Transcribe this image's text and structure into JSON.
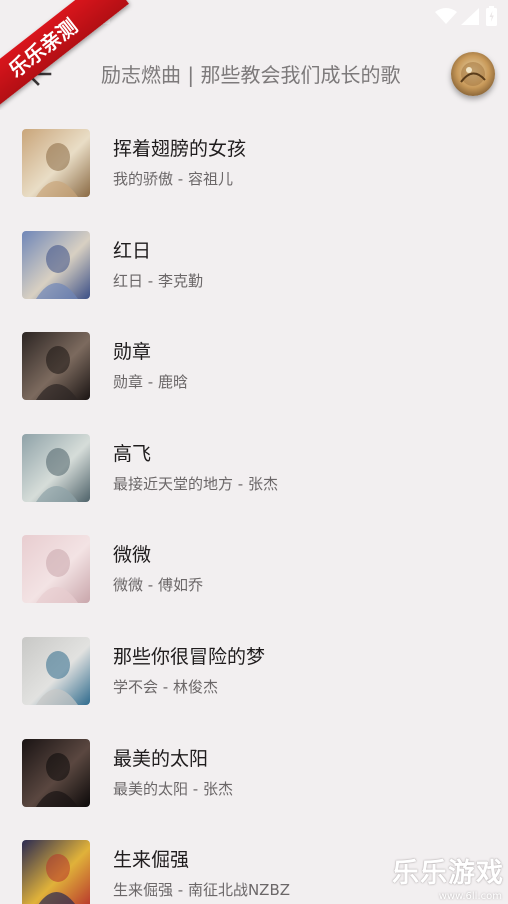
{
  "watermark": {
    "ribbon_text": "乐乐亲测",
    "logo_text": "乐乐游戏",
    "url": "www.6ll.com"
  },
  "status_bar": {
    "icons": [
      "a-notification-icon",
      "wifi-icon",
      "signal-icon",
      "battery-icon"
    ]
  },
  "app_bar": {
    "back_icon": "arrow-back-icon",
    "title": "励志燃曲 | 那些教会我们成长的歌",
    "avatar_icon": "playlist-avatar"
  },
  "songs": [
    {
      "title": "挥着翅膀的女孩",
      "subtitle": "我的骄傲 - 容祖儿",
      "cover_colors": [
        "#c9a57a",
        "#e9ddc6",
        "#8a6a44"
      ]
    },
    {
      "title": "红日",
      "subtitle": "红日 - 李克勤",
      "cover_colors": [
        "#6f86b8",
        "#d8d0c2",
        "#3b4f86"
      ]
    },
    {
      "title": "勋章",
      "subtitle": "勋章 - 鹿晗",
      "cover_colors": [
        "#2c2523",
        "#7c6a5e",
        "#1a1413"
      ]
    },
    {
      "title": "高飞",
      "subtitle": "最接近天堂的地方 - 张杰",
      "cover_colors": [
        "#8fa2a8",
        "#d6ddd9",
        "#4e6269"
      ]
    },
    {
      "title": "微微",
      "subtitle": "微微 - 傅如乔",
      "cover_colors": [
        "#e8cdd0",
        "#f3e3e4",
        "#c9a6ab"
      ]
    },
    {
      "title": "那些你很冒险的梦",
      "subtitle": "学不会 - 林俊杰",
      "cover_colors": [
        "#c8c8c6",
        "#e2e2e0",
        "#2f6b8d"
      ]
    },
    {
      "title": "最美的太阳",
      "subtitle": "最美的太阳 - 张杰",
      "cover_colors": [
        "#1a1414",
        "#5a4740",
        "#0b0909"
      ]
    },
    {
      "title": "生来倔强",
      "subtitle": "生来倔强 - 南征北战NZBZ",
      "cover_colors": [
        "#2a2a52",
        "#e0b23a",
        "#b7342c"
      ]
    }
  ]
}
